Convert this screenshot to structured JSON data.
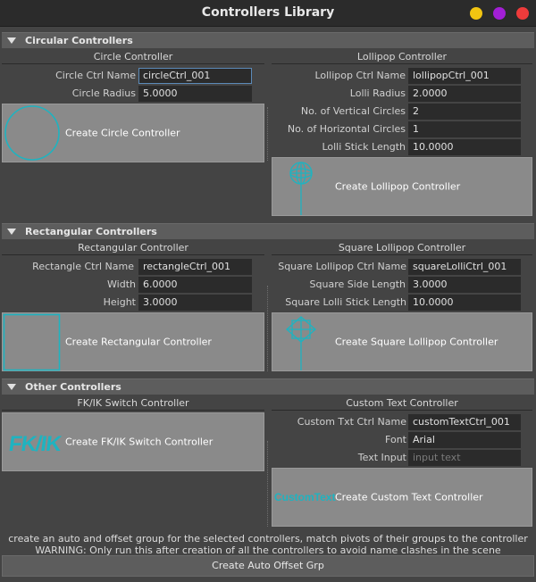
{
  "window": {
    "title": "Controllers Library",
    "buttons": [
      {
        "name": "minimize",
        "color": "#f2c511"
      },
      {
        "name": "maximize",
        "color": "#a31fd6"
      },
      {
        "name": "close",
        "color": "#ee3b3b"
      }
    ]
  },
  "sections": {
    "circular": "Circular Controllers",
    "rectangular": "Rectangular Controllers",
    "other": "Other Controllers"
  },
  "circle": {
    "header": "Circle Controller",
    "name_label": "Circle Ctrl Name",
    "name_value": "circleCtrl_001",
    "radius_label": "Circle Radius",
    "radius_value": "5.0000",
    "button": "Create Circle Controller"
  },
  "lollipop": {
    "header": "Lollipop Controller",
    "name_label": "Lollipop Ctrl Name",
    "name_value": "lollipopCtrl_001",
    "radius_label": "Lolli Radius",
    "radius_value": "2.0000",
    "vcircles_label": "No. of Vertical Circles",
    "vcircles_value": "2",
    "hcircles_label": "No. of Horizontal Circles",
    "hcircles_value": "1",
    "stick_label": "Lolli Stick Length",
    "stick_value": "10.0000",
    "button": "Create Lollipop Controller"
  },
  "rectangle": {
    "header": "Rectangular Controller",
    "name_label": "Rectangle Ctrl Name",
    "name_value": "rectangleCtrl_001",
    "width_label": "Width",
    "width_value": "6.0000",
    "height_label": "Height",
    "height_value": "3.0000",
    "button": "Create Rectangular Controller"
  },
  "square_lollipop": {
    "header": "Square Lollipop Controller",
    "name_label": "Square Lollipop Ctrl Name",
    "name_value": "squareLolliCtrl_001",
    "side_label": "Square Side Length",
    "side_value": "3.0000",
    "stick_label": "Square Lolli Stick Length",
    "stick_value": "10.0000",
    "button": "Create Square Lollipop Controller"
  },
  "fkik": {
    "header": "FK/IK Switch Controller",
    "icon_text": "FK/IK",
    "button": "Create FK/IK Switch Controller"
  },
  "custom_text": {
    "header": "Custom Text Controller",
    "name_label": "Custom Txt Ctrl Name",
    "name_value": "customTextCtrl_001",
    "font_label": "Font",
    "font_value": "Arial",
    "text_label": "Text Input",
    "text_placeholder": "input text",
    "icon_text": "CustomText",
    "button": "Create Custom Text Controller"
  },
  "footer": {
    "line1": "create an auto and offset group for the selected controllers, match pivots of their groups to the controller",
    "line2": "WARNING: Only run this after creation of all the controllers to avoid name clashes in the scene",
    "button": "Create Auto Offset Grp"
  },
  "colors": {
    "accent": "#1fb3c0",
    "section_bg": "#5d5d5d",
    "button_bg": "#8a8a8a"
  }
}
